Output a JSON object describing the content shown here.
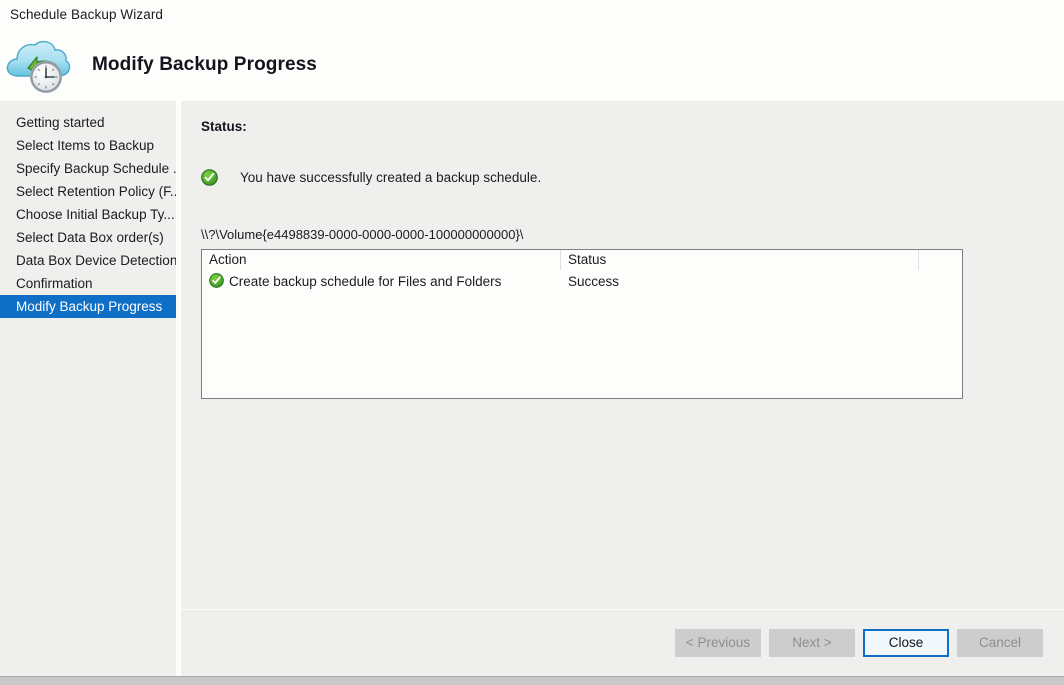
{
  "window": {
    "title": "Schedule Backup Wizard",
    "header_title": "Modify Backup Progress",
    "header_icon": "cloud-clock-backup-icon"
  },
  "sidebar": {
    "items": [
      {
        "label": "Getting started",
        "active": false
      },
      {
        "label": "Select Items to Backup",
        "active": false
      },
      {
        "label": "Specify Backup Schedule ...",
        "active": false
      },
      {
        "label": "Select Retention Policy (F...",
        "active": false
      },
      {
        "label": "Choose Initial Backup Ty...",
        "active": false
      },
      {
        "label": "Select Data Box order(s)",
        "active": false
      },
      {
        "label": "Data Box Device Detection",
        "active": false
      },
      {
        "label": "Confirmation",
        "active": false
      },
      {
        "label": "Modify Backup Progress",
        "active": true
      }
    ]
  },
  "main": {
    "status_label": "Status:",
    "success_icon": "green-check-circle-icon",
    "success_message": "You have successfully created a backup schedule.",
    "volume_path": "\\\\?\\Volume{e4498839-0000-0000-0000-100000000000}\\",
    "table": {
      "columns": [
        "Action",
        "Status"
      ],
      "rows": [
        {
          "icon": "green-check-circle-icon",
          "action": "Create backup schedule for Files and Folders",
          "status": "Success"
        }
      ]
    }
  },
  "footer": {
    "buttons": [
      {
        "label": "< Previous",
        "state": "disabled"
      },
      {
        "label": "Next >",
        "state": "disabled"
      },
      {
        "label": "Close",
        "state": "default-focused"
      },
      {
        "label": "Cancel",
        "state": "disabled"
      }
    ]
  },
  "colors": {
    "accent": "#0f6fc6",
    "panel": "#eff0ee",
    "success": "#3aa033",
    "disabled_button": "#cdcdcd"
  }
}
